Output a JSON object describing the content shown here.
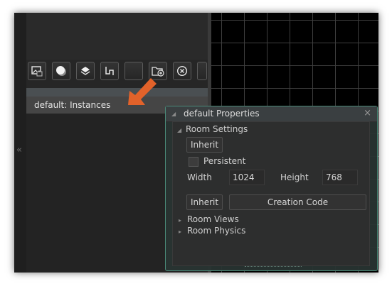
{
  "instances_panel": {
    "header_label": "default: Instances",
    "collapse_glyph": "«",
    "toolbar_icons": [
      "image-icon",
      "circle-icon",
      "layers-icon",
      "path-icon",
      "hidden-icon",
      "folder-add-icon",
      "close-circle-icon"
    ]
  },
  "properties_dialog": {
    "title": "default Properties",
    "close_glyph": "×",
    "room_settings": {
      "heading": "Room Settings",
      "inherit_label": "Inherit",
      "persistent_label": "Persistent",
      "persistent_checked": false,
      "width_label": "Width",
      "width_value": "1024",
      "height_label": "Height",
      "height_value": "768",
      "inherit2_label": "Inherit",
      "creation_code_label": "Creation Code"
    },
    "room_views_label": "Room Views",
    "room_physics_label": "Room Physics"
  },
  "colors": {
    "accent": "#4a8a78",
    "pointer_arrow": "#e2622a"
  }
}
